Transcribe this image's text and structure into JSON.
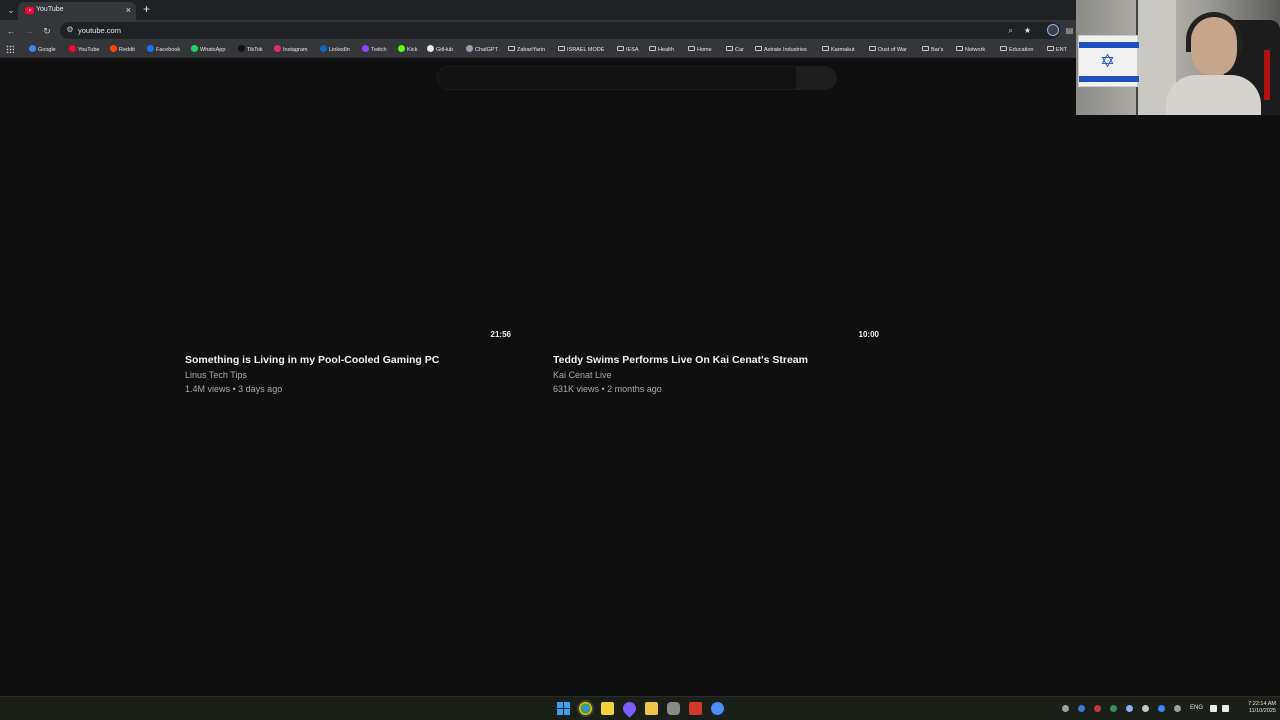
{
  "browser": {
    "tab": {
      "title": "YouTube",
      "close": "×"
    },
    "new_tab": "+",
    "url": "youtube.com",
    "bookmarks": [
      {
        "label": "Google",
        "kind": "site",
        "color": "#4285f4"
      },
      {
        "label": "YouTube",
        "kind": "site",
        "color": "#ff0033"
      },
      {
        "label": "Reddit",
        "kind": "site",
        "color": "#ff4500"
      },
      {
        "label": "Facebook",
        "kind": "site",
        "color": "#1877f2"
      },
      {
        "label": "WhatsApp",
        "kind": "site",
        "color": "#25d366"
      },
      {
        "label": "TikTok",
        "kind": "site",
        "color": "#111111"
      },
      {
        "label": "Instagram",
        "kind": "site",
        "color": "#e1306c"
      },
      {
        "label": "LinkedIn",
        "kind": "site",
        "color": "#0a66c2"
      },
      {
        "label": "Twitch",
        "kind": "site",
        "color": "#9146ff"
      },
      {
        "label": "Kick",
        "kind": "site",
        "color": "#53fc18"
      },
      {
        "label": "GitHub",
        "kind": "site",
        "color": "#e8eaed"
      },
      {
        "label": "ChatGPT",
        "kind": "site",
        "color": "#9aa0a6"
      },
      {
        "label": "ZabariYarin",
        "kind": "folder"
      },
      {
        "label": "ISRAEL MODE",
        "kind": "folder"
      },
      {
        "label": "IESA",
        "kind": "folder"
      },
      {
        "label": "Health",
        "kind": "folder"
      },
      {
        "label": "Home",
        "kind": "folder"
      },
      {
        "label": "Car",
        "kind": "folder"
      },
      {
        "label": "Astrate Industries",
        "kind": "folder"
      },
      {
        "label": "Karmakut",
        "kind": "folder"
      },
      {
        "label": "Dust of War",
        "kind": "folder"
      },
      {
        "label": "Bar's",
        "kind": "folder"
      },
      {
        "label": "Network",
        "kind": "folder"
      },
      {
        "label": "Education",
        "kind": "folder"
      },
      {
        "label": "ENT",
        "kind": "folder"
      }
    ]
  },
  "videos": [
    {
      "title": "Something is Living in my Pool-Cooled Gaming PC",
      "channel": "Linus Tech Tips",
      "meta": "1.4M views • 3 days ago",
      "duration": "21:56"
    },
    {
      "title": "Teddy Swims Performs Live On Kai Cenat's Stream",
      "channel": "Kai Cenat Live",
      "meta": "631K views • 2 months ago",
      "duration": "10:00"
    }
  ],
  "taskbar": {
    "language": "ENG",
    "time": "7:22:14 AM",
    "date": "11/10/2025"
  }
}
